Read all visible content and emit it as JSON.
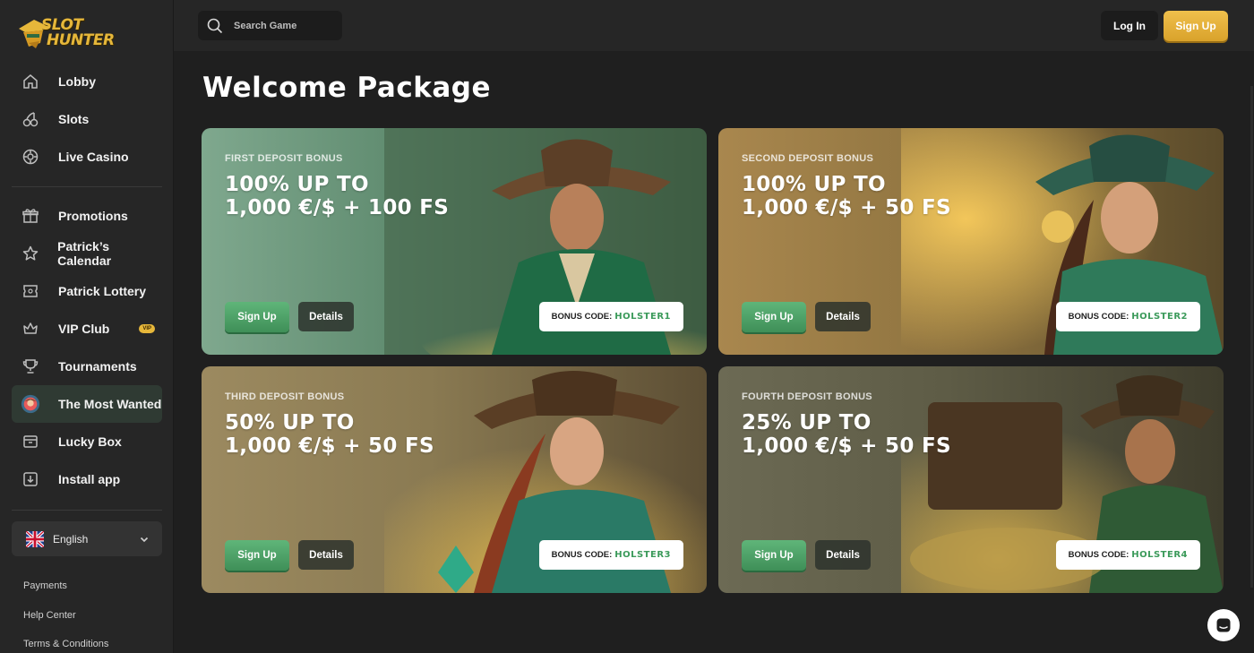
{
  "brand": {
    "line1": "SLOT",
    "line2": "HUNTER"
  },
  "search": {
    "placeholder": "Search Game"
  },
  "header": {
    "login_label": "Log In",
    "signup_label": "Sign Up"
  },
  "sidebar": {
    "items": [
      {
        "label": "Lobby",
        "icon": "home-icon"
      },
      {
        "label": "Slots",
        "icon": "cherries-icon"
      },
      {
        "label": "Live Casino",
        "icon": "chip-icon"
      },
      {
        "label": "Promotions",
        "icon": "gift-icon"
      },
      {
        "label": "Patrick’s Calendar",
        "icon": "star-icon"
      },
      {
        "label": "Patrick Lottery",
        "icon": "ticket-icon"
      },
      {
        "label": "VIP Club",
        "icon": "crown-icon",
        "badge": "VIP"
      },
      {
        "label": "Tournaments",
        "icon": "trophy-icon"
      },
      {
        "label": "The Most Wanted",
        "icon": "wanted-avatar-icon"
      },
      {
        "label": "Lucky Box",
        "icon": "box-icon"
      },
      {
        "label": "Install app",
        "icon": "download-icon"
      }
    ],
    "language": "English",
    "footer_links": [
      "Payments",
      "Help Center",
      "Terms & Conditions"
    ]
  },
  "main": {
    "title": "Welcome Package",
    "cards": [
      {
        "kicker": "FIRST DEPOSIT BONUS",
        "line1": "100% UP TO",
        "line2": "1,000 €/$ + 100 FS",
        "signup": "Sign Up",
        "details": "Details",
        "code_label": "BONUS CODE:",
        "code": "HOLSTER1"
      },
      {
        "kicker": "SECOND DEPOSIT BONUS",
        "line1": "100% UP TO",
        "line2": "1,000 €/$ + 50 FS",
        "signup": "Sign Up",
        "details": "Details",
        "code_label": "BONUS CODE:",
        "code": "HOLSTER2"
      },
      {
        "kicker": "THIRD DEPOSIT BONUS",
        "line1": "50% UP TO",
        "line2": "1,000 €/$ + 50 FS",
        "signup": "Sign Up",
        "details": "Details",
        "code_label": "BONUS CODE:",
        "code": "HOLSTER3"
      },
      {
        "kicker": "FOURTH DEPOSIT BONUS",
        "line1": "25% UP TO",
        "line2": "1,000 €/$ + 50 FS",
        "signup": "Sign Up",
        "details": "Details",
        "code_label": "BONUS CODE:",
        "code": "HOLSTER4"
      }
    ]
  },
  "colors": {
    "accent_gold": "#e6b73a",
    "accent_green": "#4fa56a",
    "code_green": "#3b9a5a"
  }
}
